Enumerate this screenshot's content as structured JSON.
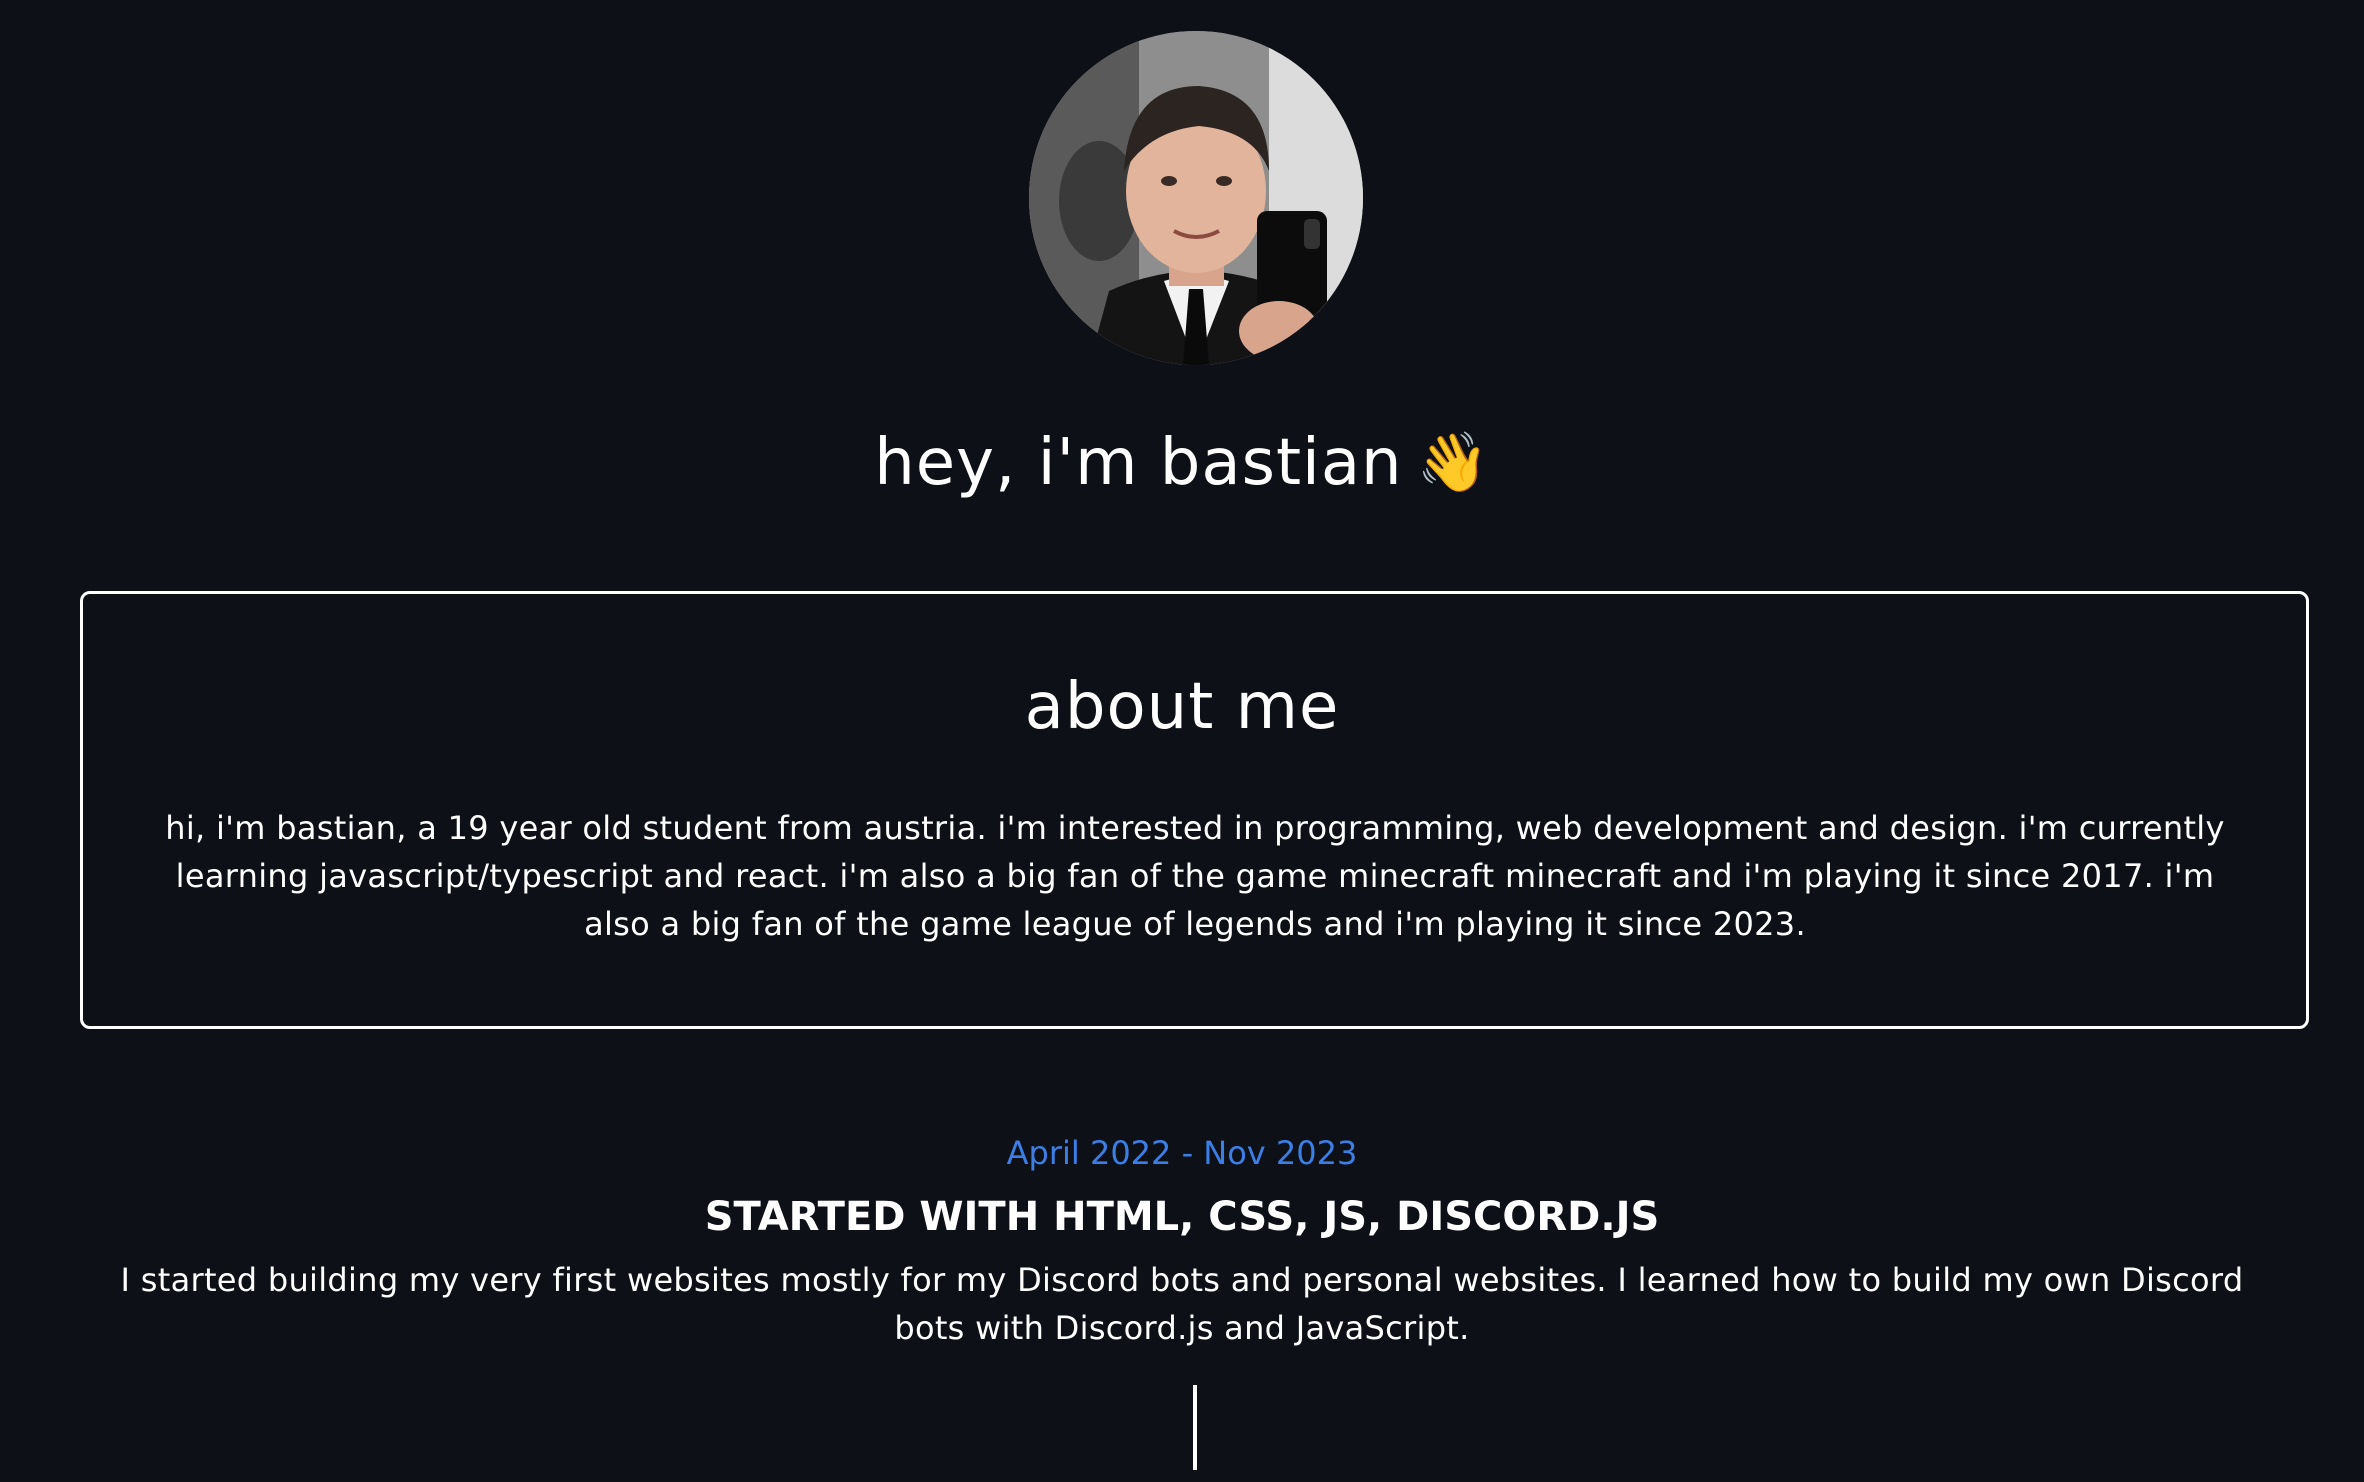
{
  "hero": {
    "avatar_alt": "profile photo",
    "greeting": "hey, i'm bastian",
    "wave_emoji": "👋"
  },
  "about": {
    "title": "about me",
    "text": "hi, i'm bastian, a 19 year old student from austria. i'm interested in programming, web development and design. i'm currently learning javascript/typescript and react. i'm also a big fan of the game minecraft minecraft and i'm playing it since 2017. i'm also a big fan of the game league of legends and i'm playing it since 2023."
  },
  "timeline": [
    {
      "date": "April 2022 - Nov 2023",
      "title": "STARTED WITH HTML, CSS, JS, DISCORD.JS",
      "description": "I started building my very first websites mostly for my Discord bots and personal websites. I learned how to build my own Discord bots with Discord.js and JavaScript."
    }
  ],
  "colors": {
    "background": "#0d1017",
    "text": "#ffffff",
    "accent": "#3b7fe6"
  }
}
